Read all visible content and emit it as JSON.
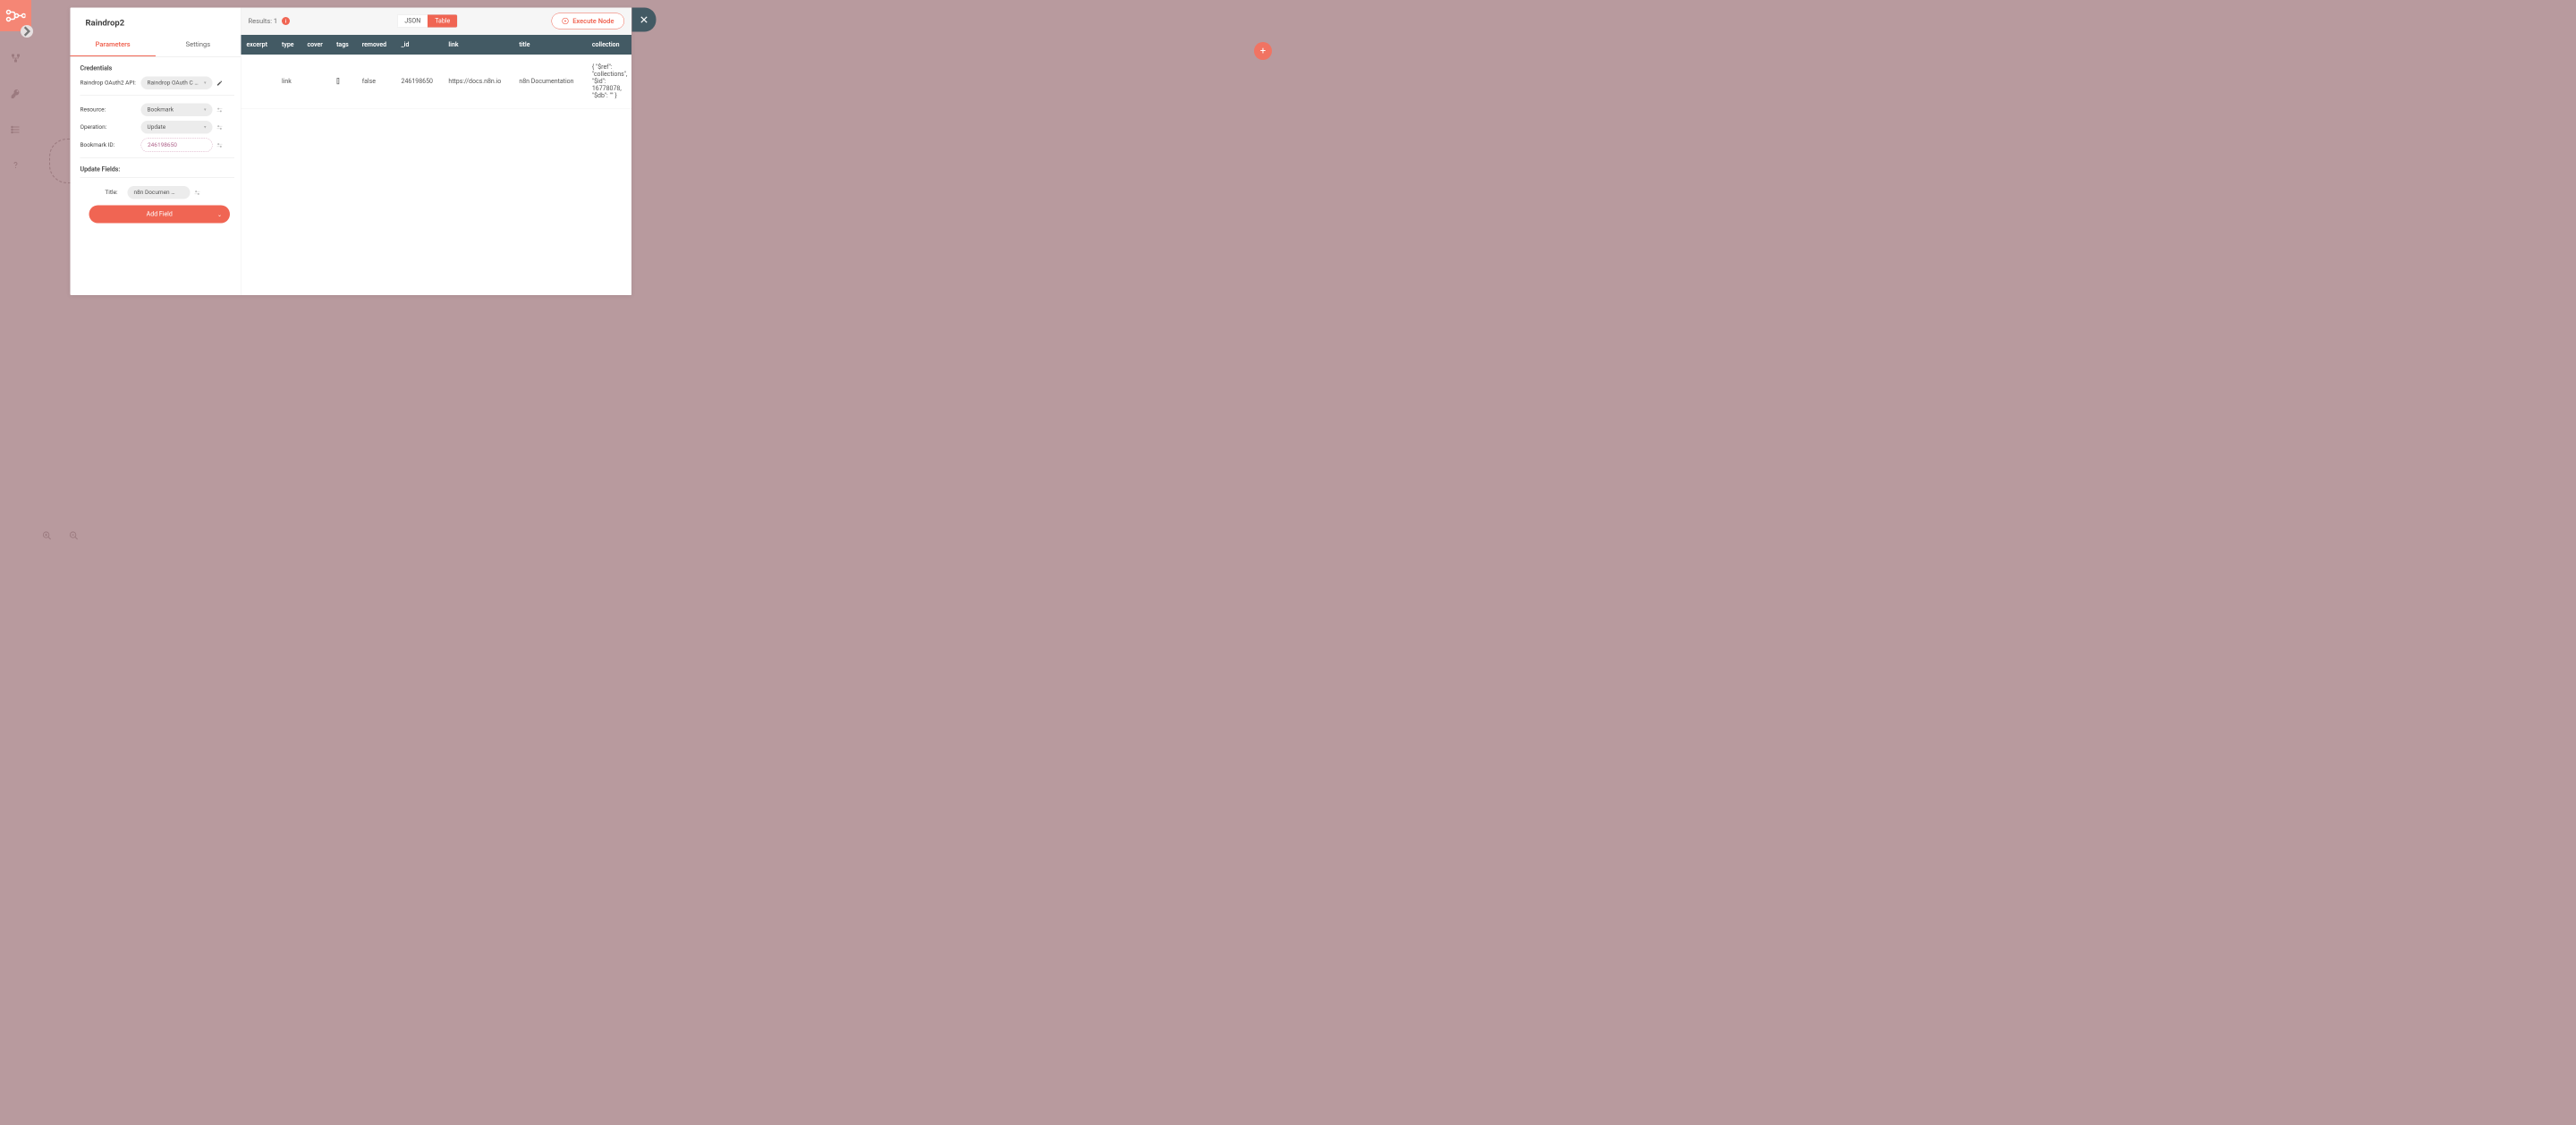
{
  "sidebar": {
    "icons": [
      "workflow",
      "hierarchy",
      "key",
      "list",
      "help"
    ]
  },
  "node": {
    "title": "Raindrop2",
    "tabs": {
      "parameters": "Parameters",
      "settings": "Settings"
    },
    "credentials_label": "Credentials",
    "cred_api_label": "Raindrop OAuth2 API:",
    "cred_api_value": "Raindrop OAuth C …",
    "params": {
      "resource": {
        "label": "Resource:",
        "value": "Bookmark"
      },
      "operation": {
        "label": "Operation:",
        "value": "Update"
      },
      "bookmark_id": {
        "label": "Bookmark ID:",
        "value": "246198650"
      }
    },
    "update_fields_label": "Update Fields:",
    "title_field": {
      "label": "Title:",
      "value": "n8n Documen …"
    },
    "add_field": "Add Field"
  },
  "results": {
    "label": "Results: 1",
    "view": {
      "json": "JSON",
      "table": "Table"
    },
    "execute": "Execute Node",
    "headers": [
      "excerpt",
      "type",
      "cover",
      "tags",
      "removed",
      "_id",
      "link",
      "title",
      "collection"
    ],
    "row": {
      "excerpt": "",
      "type": "link",
      "cover": "",
      "tags": "[]",
      "removed": "false",
      "_id": "246198650",
      "link": "https://docs.n8n.io",
      "title": "n8n Documentation",
      "collection": "{ \"$ref\": \"collections\", \"$id\": 16778078, \"$db\": \"\" }"
    }
  }
}
